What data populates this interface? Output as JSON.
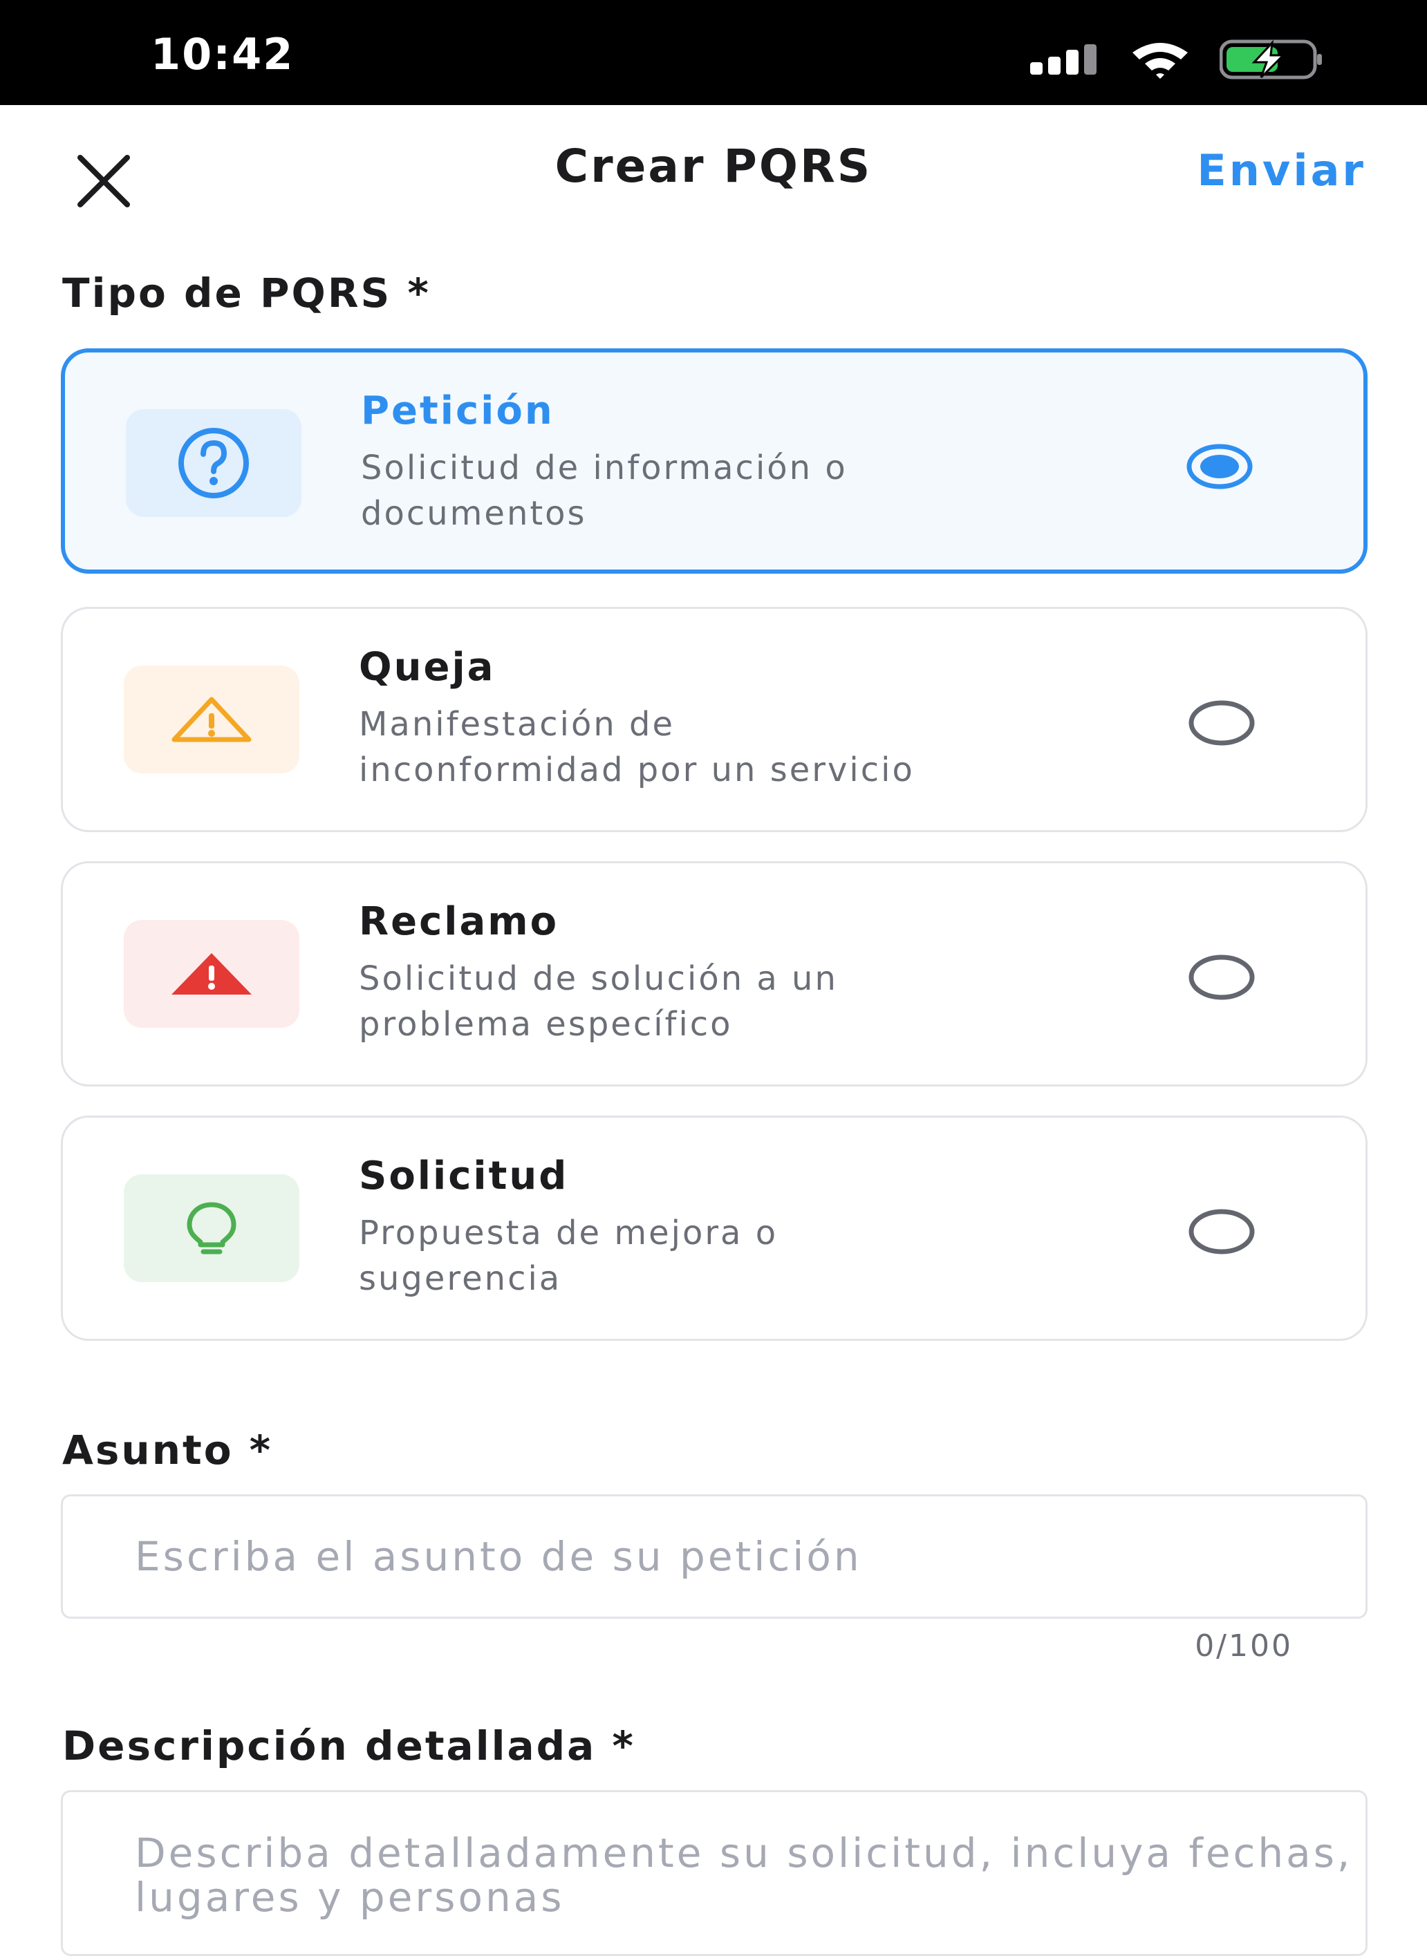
{
  "status_bar": {
    "time": "10:42",
    "icons": [
      "cellular-signal-icon",
      "wifi-icon",
      "battery-charging-icon"
    ]
  },
  "nav": {
    "close_icon": "close-icon",
    "title": "Crear PQRS",
    "send_label": "Enviar"
  },
  "colors": {
    "accent": "#2e8ff0",
    "warning": "#f5a623",
    "danger": "#e53935",
    "success": "#4caf50"
  },
  "type_section": {
    "label": "Tipo de PQRS *",
    "selected": "peticion",
    "options": [
      {
        "id": "peticion",
        "title": "Petición",
        "desc_line1": "Solicitud de información o",
        "desc_line2": "documentos",
        "icon": "question-circle-icon",
        "icon_bg": "#e2effc",
        "icon_color": "#2e8ff0"
      },
      {
        "id": "queja",
        "title": "Queja",
        "desc_line1": "Manifestación de",
        "desc_line2": "inconformidad por un servicio",
        "icon": "warning-outline-icon",
        "icon_bg": "#fef3e6",
        "icon_color": "#f5a623"
      },
      {
        "id": "reclamo",
        "title": "Reclamo",
        "desc_line1": "Solicitud de solución a un",
        "desc_line2": "problema específico",
        "icon": "alert-triangle-filled-icon",
        "icon_bg": "#fdecec",
        "icon_color": "#e53935"
      },
      {
        "id": "solicitud",
        "title": "Solicitud",
        "desc_line1": "Propuesta de mejora o",
        "desc_line2": "sugerencia",
        "icon": "lightbulb-icon",
        "icon_bg": "#e9f5ea",
        "icon_color": "#4caf50"
      }
    ]
  },
  "subject": {
    "label": "Asunto *",
    "value": "",
    "placeholder": "Escriba el asunto de su petición",
    "counter": "0/100"
  },
  "description": {
    "label": "Descripción detallada *",
    "value": "",
    "placeholder": "Describa detalladamente su solicitud, incluya fechas, lugares y personas"
  }
}
